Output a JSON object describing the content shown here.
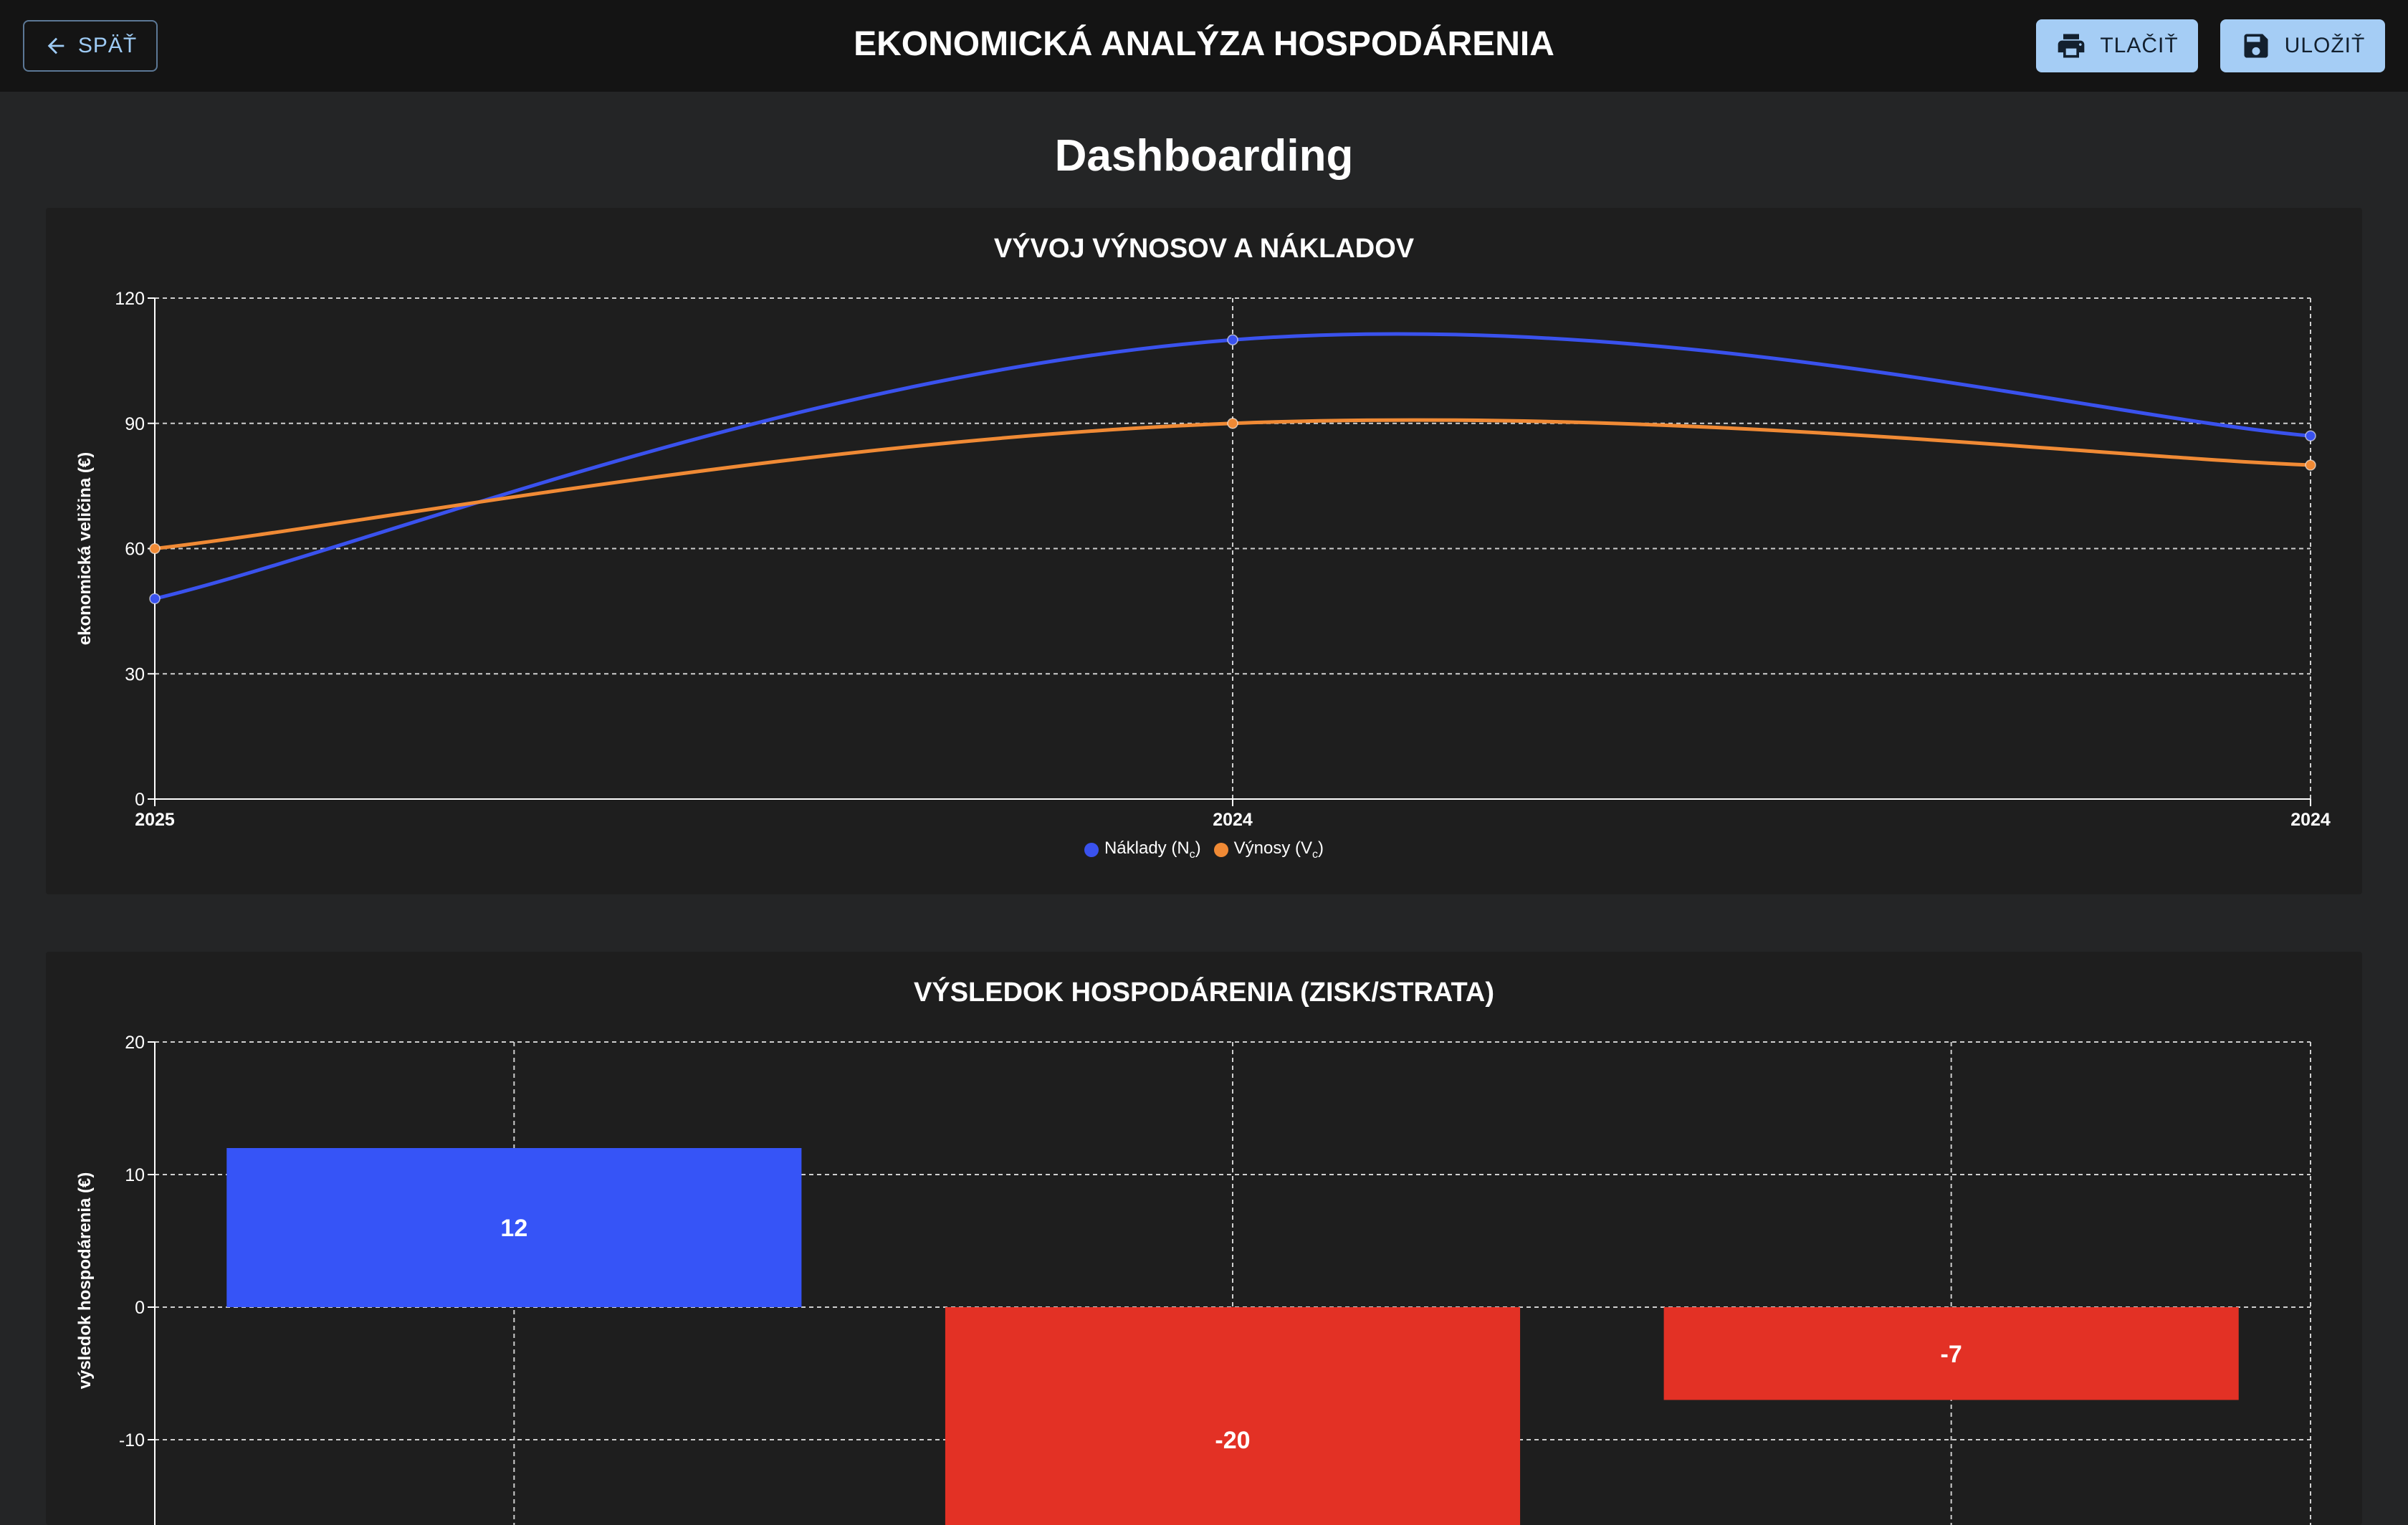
{
  "header": {
    "back_label": "SPÄŤ",
    "title": "EKONOMICKÁ ANALÝZA HOSPODÁRENIA",
    "print_label": "TLAČIŤ",
    "save_label": "ULOŽIŤ"
  },
  "page": {
    "title": "Dashboarding"
  },
  "colors": {
    "costs": "#3a52ee",
    "revenues": "#f08a35",
    "profit": "#3654f7",
    "loss": "#e33125",
    "grid": "#cfcfcf"
  },
  "icons": {
    "back": "arrow-left-icon",
    "print": "printer-icon",
    "save": "floppy-disk-icon"
  },
  "chart_data": [
    {
      "type": "line",
      "title": "VÝVOJ VÝNOSOV A NÁKLADOV",
      "xlabel": "",
      "ylabel": "ekonomická veličina (€)",
      "categories": [
        "2025",
        "2024",
        "2024"
      ],
      "ylim": [
        0,
        120
      ],
      "yticks": [
        0,
        30,
        60,
        90,
        120
      ],
      "grid": true,
      "legend_position": "bottom-center",
      "series": [
        {
          "name": "Náklady (Nc)",
          "legend_main": "Náklady (N",
          "legend_sub": "c",
          "legend_end": ")",
          "values": [
            48,
            110,
            87
          ]
        },
        {
          "name": "Výnosy (Vc)",
          "legend_main": "Výnosy (V",
          "legend_sub": "c",
          "legend_end": ")",
          "values": [
            60,
            90,
            80
          ]
        }
      ]
    },
    {
      "type": "bar",
      "title": "VÝSLEDOK HOSPODÁRENIA (ZISK/STRATA)",
      "xlabel": "",
      "ylabel": "výsledok hospodárenia (€)",
      "categories": [
        "",
        "",
        ""
      ],
      "values": [
        12,
        -20,
        -7
      ],
      "ylim": [
        -10,
        20
      ],
      "yticks": [
        -10,
        0,
        10,
        20
      ],
      "grid": true
    }
  ]
}
